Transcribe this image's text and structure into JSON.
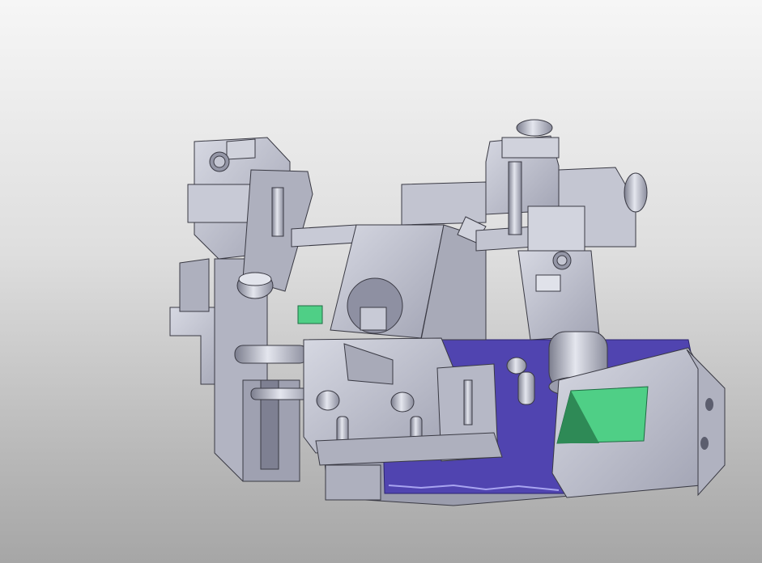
{
  "viewport": {
    "background_top": "#f6f6f6",
    "background_bottom": "#a6a6a6"
  },
  "model": {
    "colors": {
      "metal": "#b8bac8",
      "metal_light": "#d2d4df",
      "metal_dark": "#8e90a2",
      "edge": "#3a3a44",
      "accent_green": "#4fcf86",
      "accent_blue": "#5044b0"
    }
  }
}
